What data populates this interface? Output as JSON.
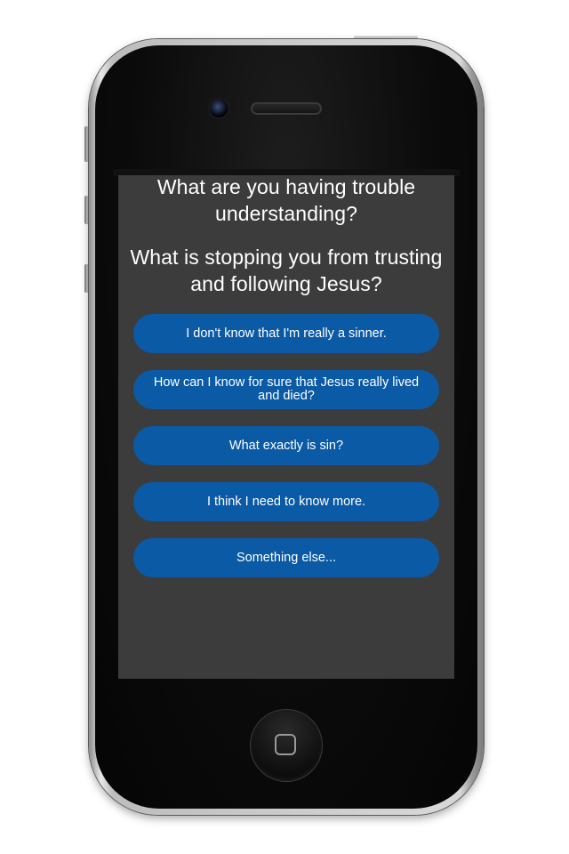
{
  "screen": {
    "question_1": "What are you having trouble understanding?",
    "question_2": "What is stopping you from trusting and following Jesus?",
    "options": [
      {
        "label": "I don't know that I'm really a sinner."
      },
      {
        "label": "How can I know for sure that Jesus really lived and died?"
      },
      {
        "label": "What exactly is sin?"
      },
      {
        "label": "I think I need to know more."
      },
      {
        "label": "Something else..."
      }
    ]
  },
  "colors": {
    "screen_background": "#3c3c3c",
    "button_background": "#0b5aa6",
    "text": "#ffffff"
  },
  "icons": {
    "home_button": "home-square-icon",
    "camera": "front-camera-icon"
  }
}
